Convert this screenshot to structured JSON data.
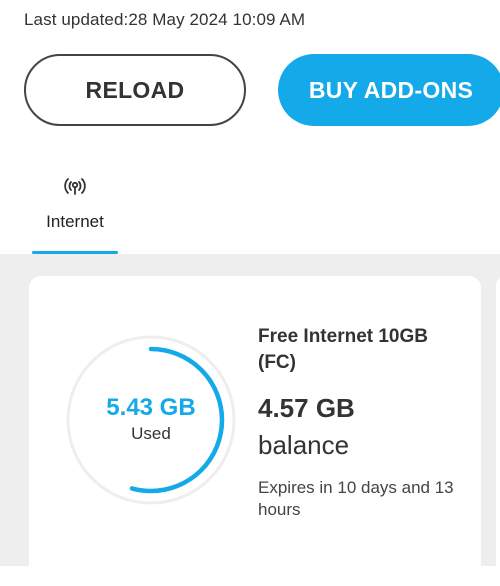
{
  "header": {
    "last_updated": "Last updated:28 May 2024 10:09 AM"
  },
  "actions": {
    "reload_label": "RELOAD",
    "buy_addons_label": "BUY ADD-ONS"
  },
  "tabs": [
    {
      "label": "Internet",
      "icon": "antenna-icon",
      "selected": true
    }
  ],
  "card": {
    "plan_name": "Free Internet 10GB (FC)",
    "used_value": "5.43 GB",
    "used_label": "Used",
    "balance_value": "4.57 GB",
    "balance_label": "balance",
    "expires": "Expires in 10 days and 13 hours",
    "used_fraction": 0.543
  },
  "colors": {
    "accent": "#14a9e8",
    "ring_track": "#eeeeee",
    "content_background": "#eeeeee"
  }
}
